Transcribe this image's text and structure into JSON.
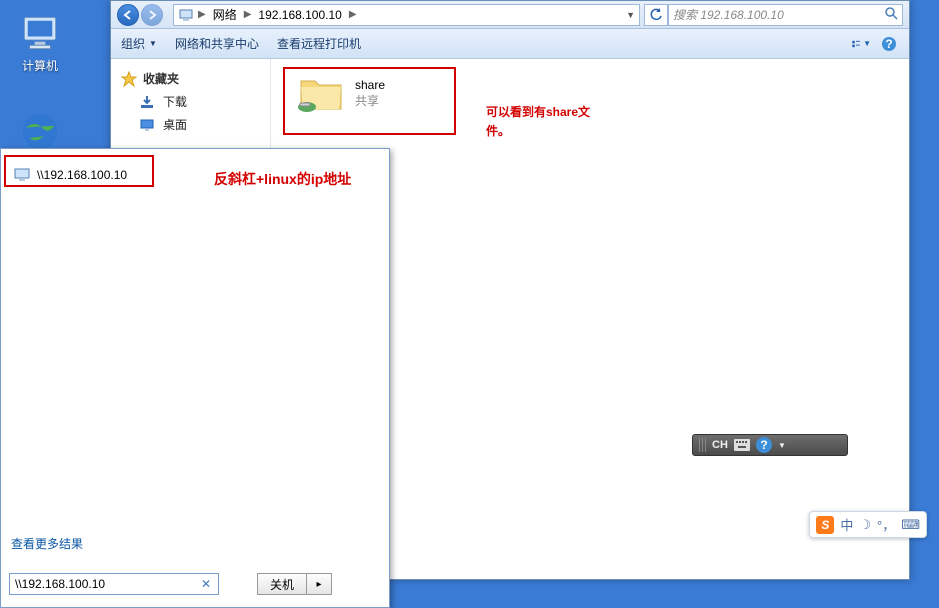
{
  "desktop": {
    "computer_label": "计算机"
  },
  "explorer": {
    "breadcrumbs": {
      "b1": "网络",
      "b2": "192.168.100.10"
    },
    "search_placeholder": "搜索 192.168.100.10",
    "cmd": {
      "organize": "组织",
      "network_center": "网络和共享中心",
      "view_printers": "查看远程打印机"
    },
    "nav": {
      "favorites": "收藏夹",
      "downloads": "下载",
      "desktop": "桌面"
    },
    "item": {
      "name": "share",
      "desc": "共享"
    }
  },
  "annotations": {
    "share_note_line1": "可以看到有share文",
    "share_note_line2": "件。",
    "ip_note": "反斜杠+linux的ip地址"
  },
  "start_panel": {
    "ip_entry": "\\\\192.168.100.10",
    "see_more": "查看更多结果",
    "search_value": "\\\\192.168.100.10",
    "shutdown": "关机"
  },
  "ime_bar": {
    "ch": "CH"
  },
  "sogou": {
    "zhong": "中",
    "moon": "☽",
    "punct": "°，",
    "kb": "⌨"
  }
}
